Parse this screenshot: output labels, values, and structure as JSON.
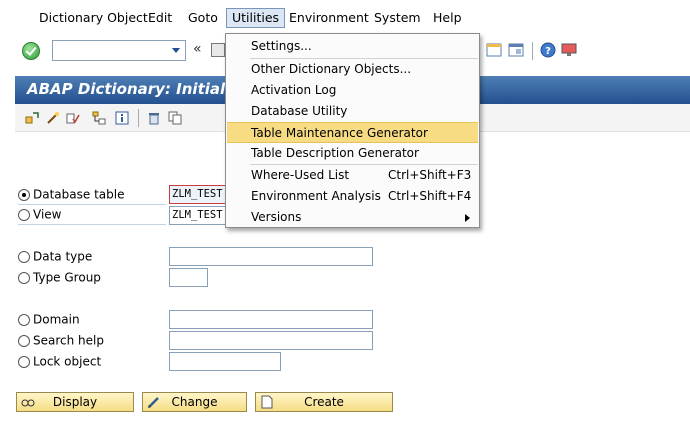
{
  "menubar": {
    "items": [
      {
        "label": "Dictionary Object"
      },
      {
        "label": "Edit"
      },
      {
        "label": "Goto"
      },
      {
        "label": "Utilities"
      },
      {
        "label": "Environment"
      },
      {
        "label": "System"
      },
      {
        "label": "Help"
      }
    ]
  },
  "toolbar": {
    "back_glyph": "«"
  },
  "title": "ABAP Dictionary: Initial",
  "form": {
    "options": [
      {
        "label": "Database table",
        "checked": true,
        "value": "ZLM_TEST"
      },
      {
        "label": "View",
        "checked": false,
        "value": "ZLM_TEST"
      },
      {
        "label": "Data type",
        "checked": false,
        "value": ""
      },
      {
        "label": "Type Group",
        "checked": false,
        "value": ""
      },
      {
        "label": "Domain",
        "checked": false,
        "value": ""
      },
      {
        "label": "Search help",
        "checked": false,
        "value": ""
      },
      {
        "label": "Lock object",
        "checked": false,
        "value": ""
      }
    ]
  },
  "buttons": {
    "display": "Display",
    "change": "Change",
    "create": "Create"
  },
  "dropdown": {
    "items": [
      {
        "label": "Settings..."
      },
      {
        "label": "Other Dictionary Objects..."
      },
      {
        "label": "Activation Log"
      },
      {
        "label": "Database Utility"
      },
      {
        "label": "Table Maintenance Generator",
        "highlighted": true
      },
      {
        "label": "Table Description Generator"
      },
      {
        "label": "Where-Used List",
        "shortcut": "Ctrl+Shift+F3"
      },
      {
        "label": "Environment Analysis",
        "shortcut": "Ctrl+Shift+F4"
      },
      {
        "label": "Versions",
        "submenu": true
      }
    ]
  },
  "colors": {
    "title_bar": "#23508e",
    "highlight": "#f8dc84",
    "button": "#f6dd85"
  }
}
